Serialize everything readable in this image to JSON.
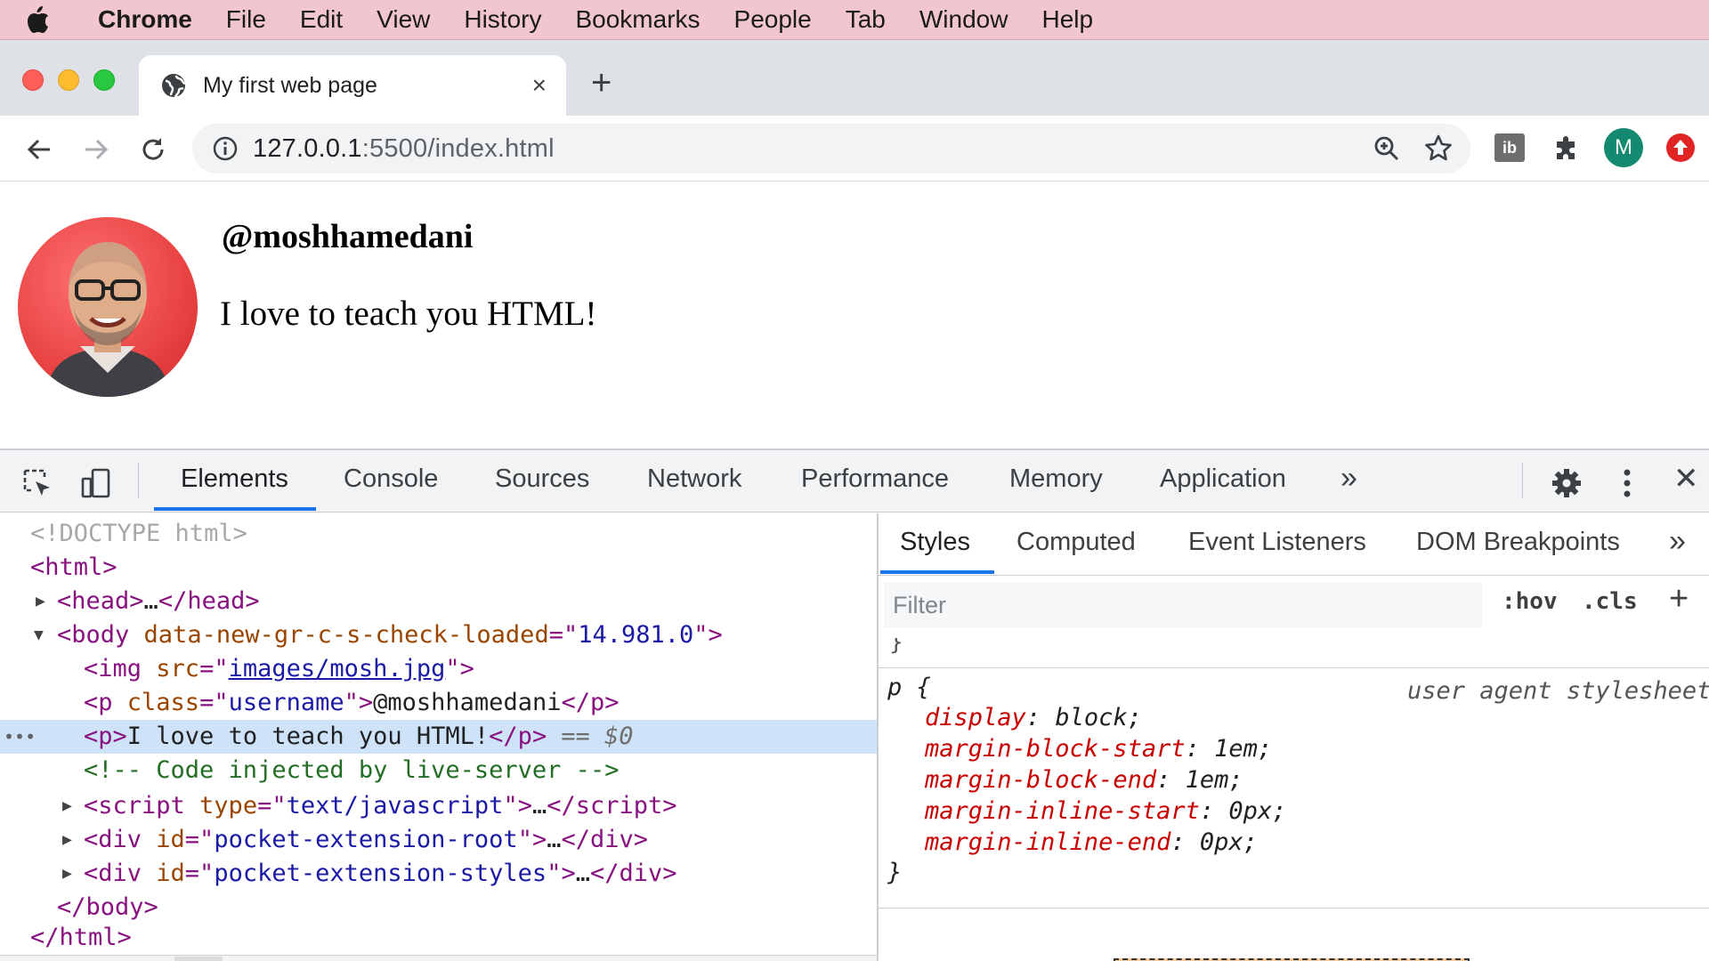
{
  "menubar": {
    "app": "Chrome",
    "items": [
      "File",
      "Edit",
      "View",
      "History",
      "Bookmarks",
      "People",
      "Tab",
      "Window",
      "Help"
    ]
  },
  "browser": {
    "tab_title": "My first web page",
    "tab_close": "×",
    "new_tab": "+",
    "url_host": "127.0.0.1",
    "url_rest": ":5500/index.html",
    "avatar_letter": "M",
    "ext_label": "ib"
  },
  "page": {
    "username": "@moshhamedani",
    "bio": "I love to teach you HTML!"
  },
  "devtools": {
    "tabs": [
      "Elements",
      "Console",
      "Sources",
      "Network",
      "Performance",
      "Memory",
      "Application"
    ],
    "more": "»",
    "close": "✕",
    "dom": {
      "doctype": "<!DOCTYPE html>",
      "html_open": "<html>",
      "head_collapsed": "…",
      "body_attr_name": "data-new-gr-c-s-check-loaded",
      "body_attr_value": "14.981.0",
      "img_src": "images/mosh.jpg",
      "p_class": "username",
      "p1_text": "@moshhamedani",
      "p2_text": "I love to teach you HTML!",
      "selected_marker": "== $0",
      "gutter_dots": "•••",
      "comment": "<!-- Code injected by live-server -->",
      "script_type": "text/javascript",
      "div1_id": "pocket-extension-root",
      "div2_id": "pocket-extension-styles",
      "body_close": "</body>",
      "html_close": "</html>"
    },
    "styles": {
      "tabs": [
        "Styles",
        "Computed",
        "Event Listeners",
        "DOM Breakpoints"
      ],
      "more": "»",
      "filter_placeholder": "Filter",
      "hov": ":hov",
      "cls": ".cls",
      "add_rule": "+",
      "selector": "p",
      "source": "user agent stylesheet",
      "declarations": [
        {
          "prop": "display",
          "value": "block"
        },
        {
          "prop": "margin-block-start",
          "value": "1em"
        },
        {
          "prop": "margin-block-end",
          "value": "1em"
        },
        {
          "prop": "margin-inline-start",
          "value": "0px"
        },
        {
          "prop": "margin-inline-end",
          "value": "0px"
        }
      ]
    }
  },
  "colors": {
    "menubar_bg": "#f1c6cf",
    "accent": "#1a73e8",
    "selected_row": "#cfe3f8",
    "avatar_bg": "#138a6f"
  }
}
